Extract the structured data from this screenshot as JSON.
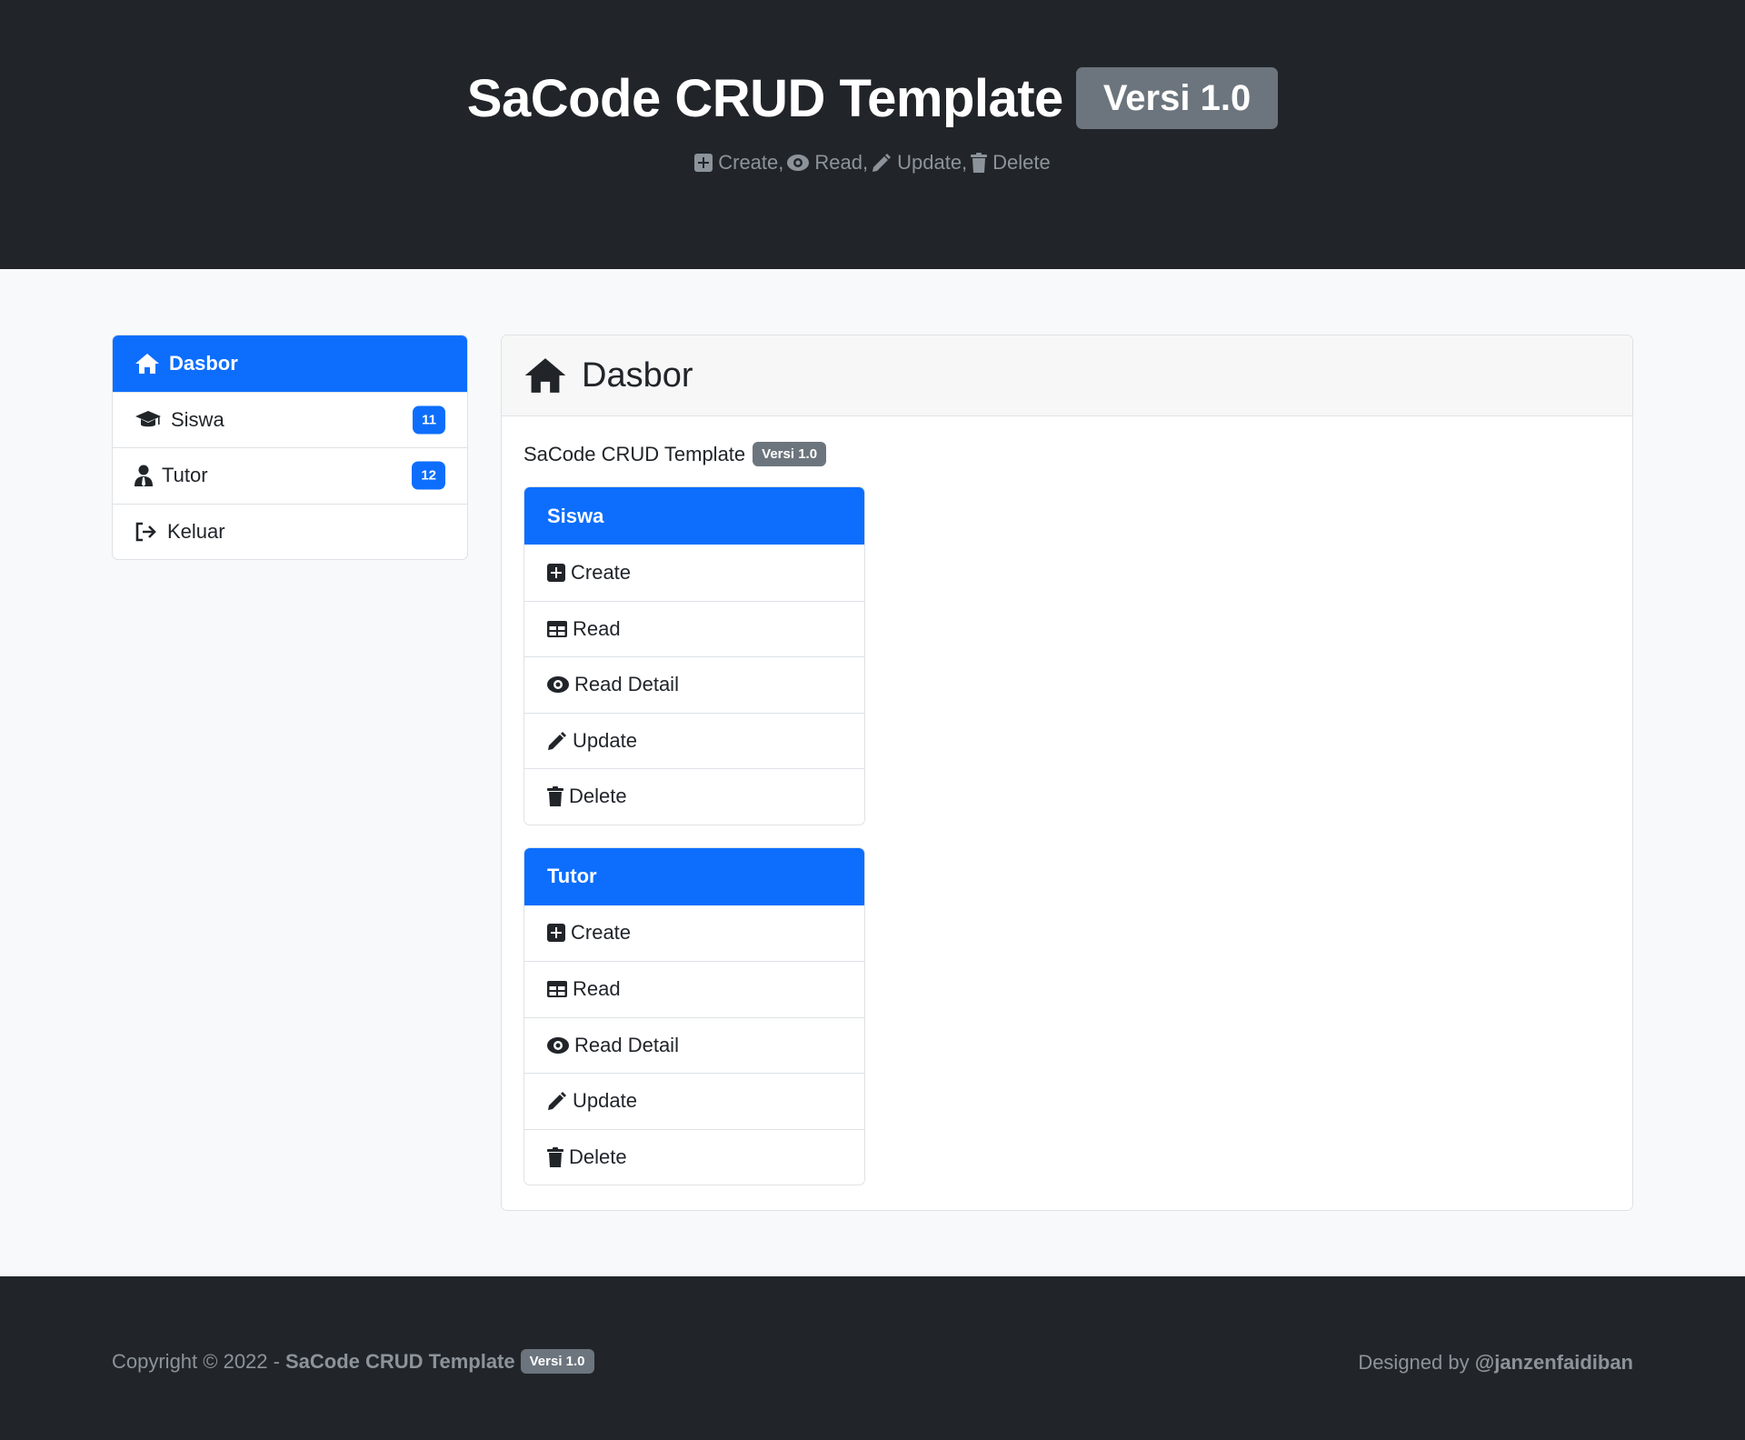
{
  "header": {
    "title": "SaCode CRUD Template",
    "version": "Versi 1.0",
    "subtitle": {
      "create": "Create,",
      "read": "Read,",
      "update": "Update,",
      "delete": "Delete"
    }
  },
  "sidebar": {
    "items": [
      {
        "label": "Dasbor",
        "icon": "home-icon",
        "active": true
      },
      {
        "label": "Siswa",
        "icon": "graduation-cap-icon",
        "badge": "11"
      },
      {
        "label": "Tutor",
        "icon": "user-tie-icon",
        "badge": "12"
      },
      {
        "label": "Keluar",
        "icon": "sign-out-icon"
      }
    ]
  },
  "main": {
    "title": "Dasbor",
    "intro": "SaCode CRUD Template",
    "intro_badge": "Versi 1.0",
    "cards": [
      {
        "title": "Siswa",
        "items": [
          "Create",
          "Read",
          "Read Detail",
          "Update",
          "Delete"
        ]
      },
      {
        "title": "Tutor",
        "items": [
          "Create",
          "Read",
          "Read Detail",
          "Update",
          "Delete"
        ]
      }
    ]
  },
  "footer": {
    "copyright": "Copyright © 2022 -",
    "brand": "SaCode CRUD Template",
    "version": "Versi 1.0",
    "designed_by": "Designed by",
    "handle": "@janzenfaidiban"
  },
  "colors": {
    "dark": "#212529",
    "primary": "#0d6efd",
    "secondary": "#6c757d",
    "muted": "#8c939a"
  }
}
